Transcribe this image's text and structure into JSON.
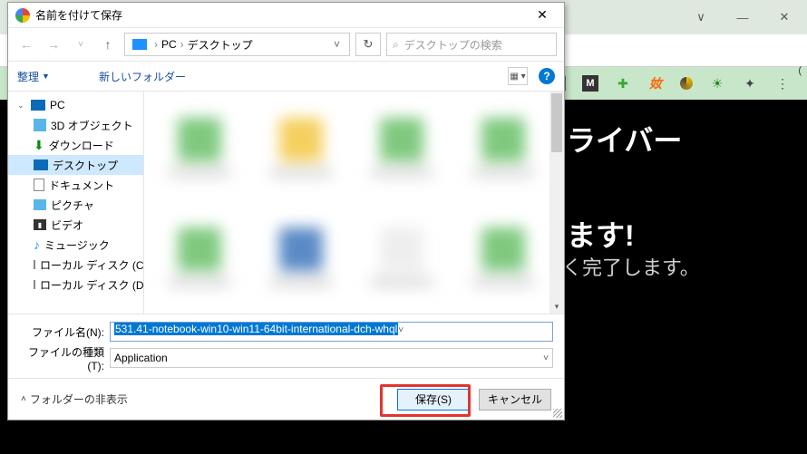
{
  "dialog": {
    "title": "名前を付けて保存",
    "nav": {
      "path": [
        "PC",
        "デスクトップ"
      ],
      "search_placeholder": "デスクトップの検索"
    },
    "toolbar": {
      "organize": "整理",
      "newfolder": "新しいフォルダー"
    },
    "tree": [
      {
        "label": "PC",
        "icon": "pc",
        "expanded": true,
        "depth": 0
      },
      {
        "label": "3D オブジェクト",
        "icon": "3d",
        "depth": 1
      },
      {
        "label": "ダウンロード",
        "icon": "dl",
        "depth": 1
      },
      {
        "label": "デスクトップ",
        "icon": "desk",
        "depth": 1,
        "selected": true
      },
      {
        "label": "ドキュメント",
        "icon": "doc",
        "depth": 1
      },
      {
        "label": "ピクチャ",
        "icon": "pic",
        "depth": 1
      },
      {
        "label": "ビデオ",
        "icon": "vid",
        "depth": 1
      },
      {
        "label": "ミュージック",
        "icon": "mus",
        "depth": 1
      },
      {
        "label": "ローカル ディスク (C:)",
        "icon": "disk",
        "depth": 1
      },
      {
        "label": "ローカル ディスク (D:)",
        "icon": "disk",
        "depth": 1
      }
    ],
    "fields": {
      "name_label": "ファイル名(N):",
      "name_value": "531.41-notebook-win10-win11-64bit-international-dch-whql",
      "type_label": "ファイルの種類(T):",
      "type_value": "Application"
    },
    "footer": {
      "hide_folders": "フォルダーの非表示",
      "save": "保存(S)",
      "cancel": "キャンセル"
    }
  },
  "background": {
    "heading1": "ライバー",
    "heading2": "ます!",
    "subline": "く完了します。"
  }
}
